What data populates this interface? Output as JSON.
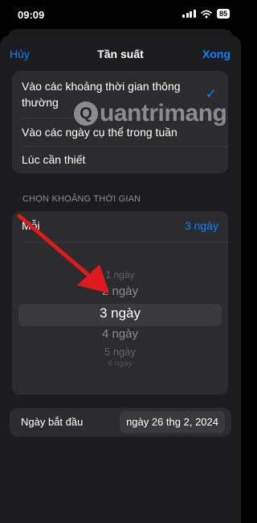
{
  "status_bar": {
    "time": "09:09",
    "battery": "85"
  },
  "sheet": {
    "nav": {
      "cancel_label": "Hủy",
      "title": "Tần suất",
      "done_label": "Xong"
    },
    "options": [
      {
        "label": "Vào các khoảng thời gian thông thường",
        "selected": true
      },
      {
        "label": "Vào các ngày cụ thể trong tuần",
        "selected": false
      },
      {
        "label": "Lúc cần thiết",
        "selected": false
      }
    ],
    "section_header": "CHỌN KHOẢNG THỜI GIAN",
    "interval": {
      "label": "Mỗi",
      "value": "3 ngày",
      "picker_items": [
        "1 ngày",
        "2 ngày",
        "3 ngày",
        "4 ngày",
        "5 ngày",
        "6 ngày"
      ],
      "selected_index": 2
    },
    "start_date": {
      "label": "Ngày bắt đầu",
      "value": "ngày 26 thg 2, 2024"
    }
  },
  "watermark": {
    "text": "uantrimang"
  },
  "colors": {
    "accent": "#0a84ff",
    "annotation_arrow": "#e0191e",
    "sheet_background": "#1c1c1e",
    "card_background": "#2c2c2e"
  },
  "icons": {
    "selected_option": "checkmark-icon",
    "wifi": "wifi-icon",
    "signal": "signal-icon",
    "battery": "battery-icon"
  }
}
